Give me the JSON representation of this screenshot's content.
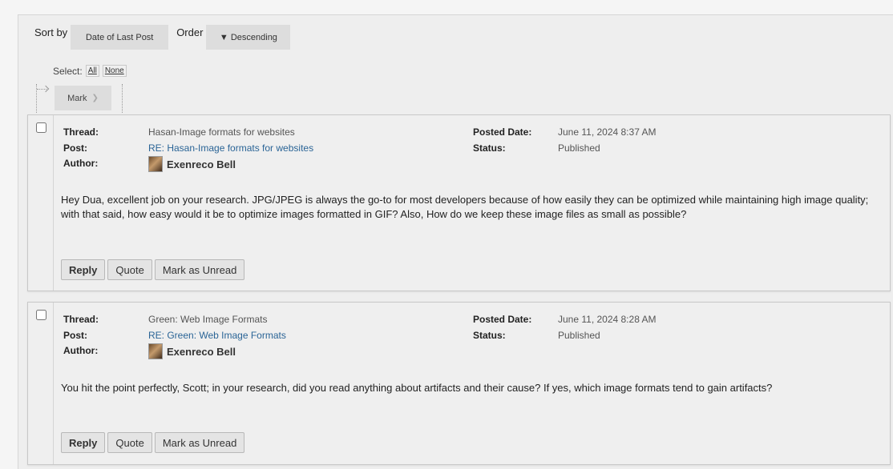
{
  "sort": {
    "sort_by_label": "Sort by",
    "sort_by_value": "Date of Last Post",
    "order_label": "Order",
    "order_value": "▼ Descending"
  },
  "select": {
    "label": "Select:",
    "all": "All",
    "none": "None"
  },
  "mark": {
    "label": "Mark",
    "chevron": "chevron-double-down-icon"
  },
  "labels": {
    "thread": "Thread:",
    "post": "Post:",
    "author": "Author:",
    "posted_date": "Posted Date:",
    "status": "Status:"
  },
  "actions": {
    "reply": "Reply",
    "quote": "Quote",
    "mark_unread": "Mark as Unread"
  },
  "posts": [
    {
      "thread": "Hasan-Image formats for websites",
      "post": "RE: Hasan-Image formats for websites",
      "author": "Exenreco Bell",
      "posted_date": "June 11, 2024 8:37 AM",
      "status": "Published",
      "body": "Hey Dua, excellent job on your research. JPG/JPEG is always the go-to for most developers because of how easily they can be optimized while maintaining high image quality; with that said, how easy would it be to optimize images formatted in GIF? Also, How do we keep these image files as small as possible?"
    },
    {
      "thread": "Green: Web Image Formats",
      "post": "RE: Green: Web Image Formats",
      "author": "Exenreco Bell",
      "posted_date": "June 11, 2024 8:28 AM",
      "status": "Published",
      "body": "You hit the point perfectly, Scott; in your research, did you read anything about artifacts and their cause? If yes, which image formats tend to gain artifacts?"
    }
  ]
}
